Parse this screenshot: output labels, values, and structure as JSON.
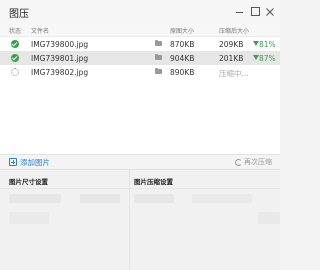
{
  "window": {
    "title": "图压"
  },
  "table": {
    "headers": {
      "status": "状态",
      "filename": "文件名",
      "original_size": "原图大小",
      "compressed_size": "压缩后大小"
    },
    "rows": [
      {
        "status": "done",
        "filename": "IMG739800.jpg",
        "original_size": "870KB",
        "compressed_size": "209KB",
        "ratio": "81%"
      },
      {
        "status": "done",
        "filename": "IMG739801.jpg",
        "original_size": "904KB",
        "compressed_size": "201KB",
        "ratio": "87%"
      },
      {
        "status": "compressing",
        "filename": "IMG739802.jpg",
        "original_size": "890KB",
        "compressed_size": "压缩中..."
      }
    ]
  },
  "actions": {
    "add_images": "添加图片",
    "recompress": "再次压缩"
  },
  "settings": {
    "size_panel_title": "图片尺寸设置",
    "compress_panel_title": "图片压缩设置"
  },
  "colors": {
    "accent": "#2b7fd8",
    "success": "#33a447"
  }
}
